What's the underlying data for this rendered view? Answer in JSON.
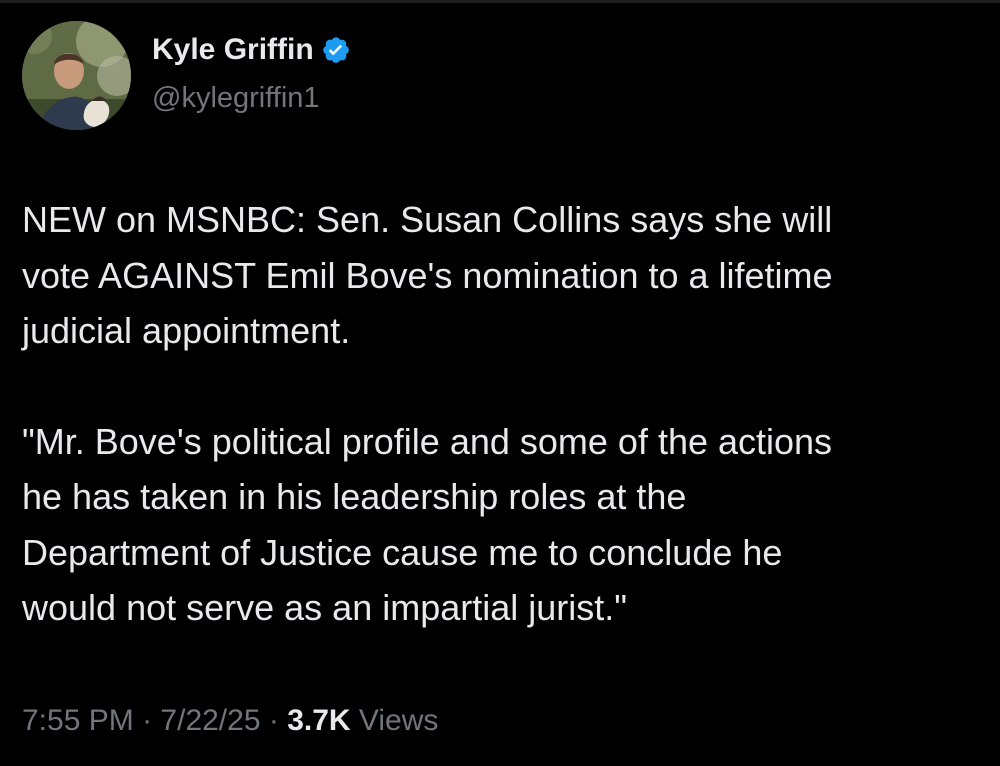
{
  "author": {
    "display_name": "Kyle Griffin",
    "handle": "@kylegriffin1",
    "verified_icon": "verified-badge-icon",
    "verified_color": "#1d9bf0",
    "avatar_icon": "profile-photo"
  },
  "tweet": {
    "paragraphs": [
      "NEW on MSNBC: Sen. Susan Collins says she will\nvote AGAINST Emil Bove's nomination to a lifetime\njudicial appointment.",
      "\"Mr. Bove's political profile and some of the actions\nhe has taken in his leadership roles at the\nDepartment of Justice cause me to conclude he\nwould not serve as an impartial jurist.\""
    ]
  },
  "meta": {
    "time": "7:55 PM",
    "separator": "·",
    "date": "7/22/25",
    "views_count": "3.7K",
    "views_label": "Views"
  },
  "colors": {
    "background": "#000000",
    "primary_text": "#e7e9ea",
    "secondary_text": "#71767b"
  }
}
